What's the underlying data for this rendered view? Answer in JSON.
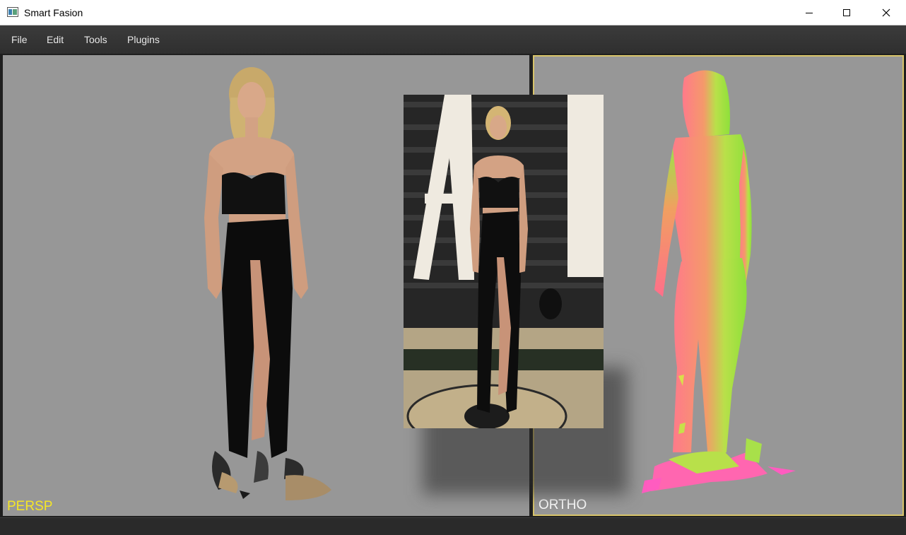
{
  "window": {
    "title": "Smart Fasion",
    "controls": [
      "minimize",
      "maximize",
      "close"
    ]
  },
  "menu": {
    "items": [
      "File",
      "Edit",
      "Tools",
      "Plugins"
    ]
  },
  "viewports": {
    "persp": {
      "label": "PERSP",
      "label_color": "#f5e626"
    },
    "ortho": {
      "label": "ORTHO",
      "label_color": "#ffffff",
      "active_border_color": "#d8c46a"
    }
  },
  "colors": {
    "viewport_bg": "#979797",
    "menubar_bg": "#333333"
  }
}
